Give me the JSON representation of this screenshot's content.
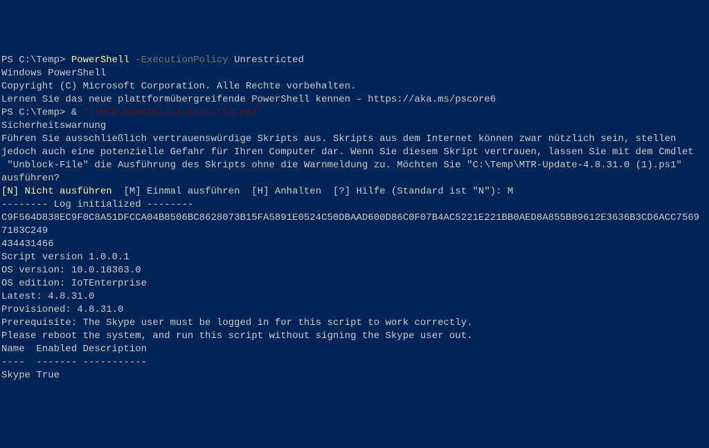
{
  "line1": {
    "prompt": "PS C:\\Temp> ",
    "cmd": "PowerShell ",
    "arg_flag": "-ExecutionPolicy ",
    "arg_val": "Unrestricted"
  },
  "line2": "Windows PowerShell",
  "line3": "Copyright (C) Microsoft Corporation. Alle Rechte vorbehalten.",
  "line4": "",
  "line5": "Lernen Sie das neue plattformübergreifende PowerShell kennen – https://aka.ms/pscore6",
  "line6": "",
  "line7": {
    "prompt": "PS C:\\Temp> ",
    "amp": "& ",
    "path": "'.\\MTR-Update-4.8.31.0 (1).ps1'"
  },
  "line8": "",
  "line9": "Sicherheitswarnung",
  "line10": "Führen Sie ausschließlich vertrauenswürdige Skripts aus. Skripts aus dem Internet können zwar nützlich sein, stellen",
  "line11": "jedoch auch eine potenzielle Gefahr für Ihren Computer dar. Wenn Sie diesem Skript vertrauen, lassen Sie mit dem Cmdlet",
  "line12": " \"Unblock-File\" die Ausführung des Skripts ohne die Warnmeldung zu. Möchten Sie \"C:\\Temp\\MTR-Update-4.8.31.0 (1).ps1\"",
  "line13": "ausführen?",
  "line14": {
    "opt_n": "[N] Nicht ausführen",
    "rest": "  [M] Einmal ausführen  [H] Anhalten  [?] Hilfe (Standard ist \"N\"): M"
  },
  "line15": "-------- Log initialized --------",
  "line16": "C9F564D838EC9F0C8A51DFCCA04B8506BC8628073B15FA5891E0524C50DBAAD600D86C0F07B4AC5221E221BB0AED8A855B89612E3636B3CD6ACC7569",
  "line17": "7183C249",
  "line18": "434431466",
  "line19": "Script version 1.0.0.1",
  "line20": "OS version: 10.0.18363.0",
  "line21": "OS edition: IoTEnterprise",
  "line22": "",
  "line23": "Latest: 4.8.31.0",
  "line24": "Provisioned: 4.8.31.0",
  "line25": "Prerequisite: The Skype user must be logged in for this script to work correctly.",
  "line26": "Please reboot the system, and run this script without signing the Skype user out.",
  "line27": "Name  Enabled Description",
  "line28": "----  ------- -----------",
  "line29": "",
  "line30": "Skype True"
}
